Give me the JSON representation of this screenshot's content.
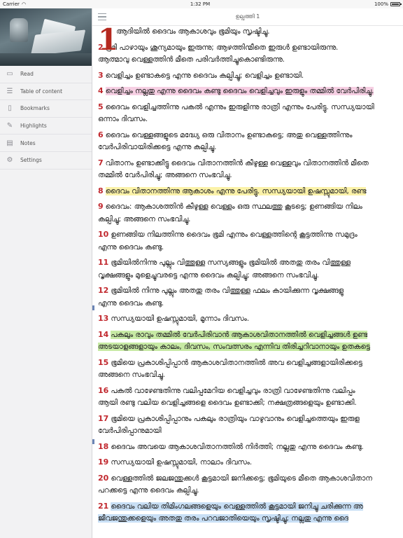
{
  "status": {
    "carrier": "Carrier",
    "time": "1:32 PM",
    "battery_label": "100%",
    "battery_level": 1.0
  },
  "sidebar": {
    "items": [
      {
        "label": "Read",
        "icon": "book-open-icon"
      },
      {
        "label": "Table of content",
        "icon": "list-icon"
      },
      {
        "label": "Bookmarks",
        "icon": "bookmark-icon"
      },
      {
        "label": "Highlights",
        "icon": "highlighter-icon"
      },
      {
        "label": "Notes",
        "icon": "notes-icon"
      },
      {
        "label": "Settings",
        "icon": "gear-icon"
      }
    ]
  },
  "header": {
    "title": "ഉല്പത്തി 1"
  },
  "chapter": {
    "dropcap": "1"
  },
  "verses": [
    {
      "num": "",
      "lines": [
        "ആദിയിൽ ദൈവം ആകാശവും ഭൂമിയും സൃഷ്ടിച്ചു."
      ]
    },
    {
      "num": "2",
      "lines": [
        "ഭൂമി പാഴായും ശൂന്യമായും ഇരുന്നു; ആഴത്തിന്മീതെ ഇരുൾ ഉണ്ടായിരുന്നു.",
        "ആത്മാവു വെള്ളത്തിൻ മീതെ പരിവർത്തിച്ചുകൊണ്ടിരുന്നു."
      ]
    },
    {
      "num": "3",
      "lines": [
        "വെളിച്ചം ഉണ്ടാകട്ടെ എന്നു ദൈവം കല്പിച്ചു; വെളിച്ചം ഉണ്ടായി."
      ]
    },
    {
      "num": "4",
      "lines": [
        "വെളിച്ചം നല്ലതു എന്നു ദൈവം കണ്ടു ദൈവം വെളിച്ചവും ഇരുളും തമ്മിൽ വേർപിരിച്ചു."
      ]
    },
    {
      "num": "5",
      "lines": [
        "ദൈവം വെളിച്ചത്തിന്നു പകൽ എന്നും ഇരുളിന്നു രാത്രി എന്നും പേരിട്ടു. സന്ധ്യയായി",
        "ഒന്നാം ദിവസം."
      ]
    },
    {
      "num": "6",
      "lines": [
        "ദൈവം വെള്ളങ്ങളുടെ മദ്ധ്യേ ഒരു വിതാനം ഉണ്ടാകട്ടെ; അതു വെള്ളത്തിന്നും",
        "വേർപിരിവായിരിക്കട്ടെ എന്നു കല്പിച്ചു."
      ]
    },
    {
      "num": "7",
      "lines": [
        "വിതാനം ഉണ്ടാക്കീട്ടു ദൈവം വിതാനത്തിൻ കീഴുള്ള വെള്ളവും വിതാനത്തിൻ മീതെ",
        "തമ്മിൽ വേർപിരിച്ചു; അങ്ങനെ സംഭവിച്ചു."
      ]
    },
    {
      "num": "8",
      "lines": [
        "ദൈവം വിതാനത്തിന്നു ആകാശം എന്നു പേരിട്ടു. സന്ധ്യയായി ഉഷസ്സുമായി, രണ്ട"
      ]
    },
    {
      "num": "9",
      "lines": [
        "ദൈവം: ആകാശത്തിൻ കീഴുള്ള വെള്ളം ഒരു സ്ഥലത്തു കൂടട്ടെ; ഉണങ്ങിയ നിലം",
        "കല്പിച്ചു; അങ്ങനെ സംഭവിച്ചു."
      ]
    },
    {
      "num": "10",
      "lines": [
        "ഉണങ്ങിയ നിലത്തിന്നു ദൈവം ഭൂമി എന്നും വെള്ളത്തിന്റെ കൂട്ടത്തിന്നു സമുദ്രം",
        "എന്നു ദൈവം കണ്ടു."
      ]
    },
    {
      "num": "11",
      "lines": [
        "ഭൂമിയിൽനിന്നു പുല്ലും വിത്തുള്ള സസ്യങ്ങളും ഭൂമിയിൽ അതതു തരം വിത്തുള്ള",
        "വൃക്ഷങ്ങളും മുളെച്ചുവരട്ടെ എന്നു ദൈവം കല്പിച്ചു; അങ്ങനെ സംഭവിച്ചു."
      ]
    },
    {
      "num": "12",
      "lines": [
        "ഭൂമിയിൽ നിന്നു പുല്ലും അതതു തരം വിത്തുള്ള ഫലം കായിക്കുന്ന വൃക്ഷങ്ങളു",
        "എന്നു ദൈവം കണ്ടു."
      ]
    },
    {
      "num": "13",
      "lines": [
        "സന്ധ്യയായി ഉഷസ്സുമായി, മൂന്നാം ദിവസം."
      ]
    },
    {
      "num": "14",
      "lines": [
        "പകലും രാവും തമ്മിൽ വേർപിരിവാൻ ആകാശവിതാനത്തിൽ വെളിച്ചങ്ങൾ ഉണ്ട",
        "അടയാളങ്ങളായും കാലം, ദിവസം, സംവത്സരം എന്നിവ തിരിച്ചറിവാനായും ഉതകട്ടെ"
      ]
    },
    {
      "num": "15",
      "lines": [
        "ഭൂമിയെ പ്രകാശിപ്പിപ്പാൻ ആകാശവിതാനത്തിൽ അവ വെളിച്ചങ്ങളായിരിക്കട്ടെ",
        "അങ്ങനെ സംഭവിച്ചു."
      ]
    },
    {
      "num": "16",
      "lines": [
        "പകൽ വാഴേണ്ടതിന്നു വലിപ്പമേറിയ വെളിച്ചവും രാത്രി വാഴേണ്ടതിന്നു വലിപ്പം",
        "ആയി രണ്ടു വലിയ വെളിച്ചങ്ങളെ ദൈവം ഉണ്ടാക്കി; നക്ഷത്രങ്ങളെയും ഉണ്ടാക്കി."
      ]
    },
    {
      "num": "17",
      "lines": [
        "ഭൂമിയെ പ്രകാശിപ്പിപ്പാനും പകലും രാത്രിയും വാഴുവാനും വെളിച്ചത്തെയും ഇരുള",
        "വേർപിരിപ്പാനുമായി"
      ]
    },
    {
      "num": "18",
      "lines": [
        "ദൈവം അവയെ ആകാശവിതാനത്തിൽ നിർത്തി; നല്ലതു എന്നു ദൈവം കണ്ടു."
      ]
    },
    {
      "num": "19",
      "lines": [
        "സന്ധ്യയായി ഉഷസ്സുമായി, നാലാം ദിവസം."
      ]
    },
    {
      "num": "20",
      "lines": [
        "വെള്ളത്തിൽ ജലജന്തുക്കൾ കൂട്ടമായി ജനിക്കട്ടെ; ഭൂമിയുടെ മീതെ ആകാശവിതാന",
        "പറക്കട്ടെ എന്നു ദൈവം കല്പിച്ചു."
      ]
    },
    {
      "num": "21",
      "lines": [
        "ദൈവം വലിയ തിമിംഗലങ്ങളെയും വെള്ളത്തിൽ കൂട്ടമായി ജനിച്ചു ചരിക്കുന്ന അ",
        "ജീവജന്തുക്കളെയും അതതു തരം പറവജാതിയെയും സൃഷ്ടിച്ചു; നല്ലതു എന്നു ദൈ"
      ]
    }
  ]
}
